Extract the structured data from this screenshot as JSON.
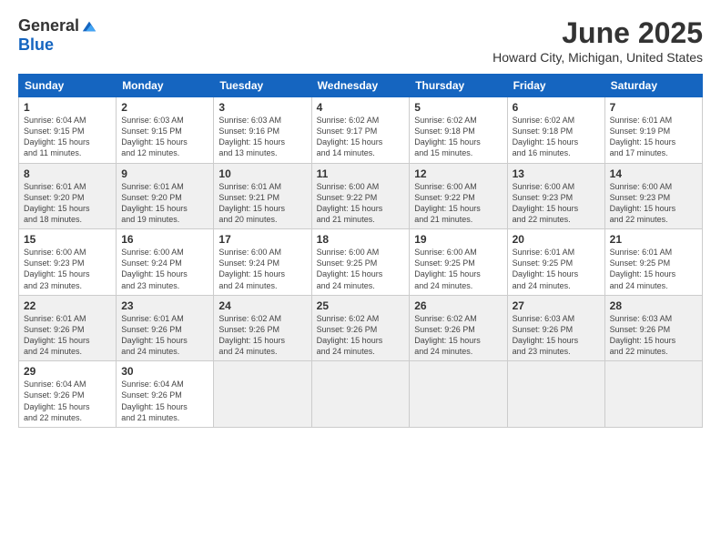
{
  "logo": {
    "general": "General",
    "blue": "Blue"
  },
  "title": "June 2025",
  "subtitle": "Howard City, Michigan, United States",
  "headers": [
    "Sunday",
    "Monday",
    "Tuesday",
    "Wednesday",
    "Thursday",
    "Friday",
    "Saturday"
  ],
  "weeks": [
    [
      {
        "num": "1",
        "info": "Sunrise: 6:04 AM\nSunset: 9:15 PM\nDaylight: 15 hours\nand 11 minutes.",
        "shaded": false
      },
      {
        "num": "2",
        "info": "Sunrise: 6:03 AM\nSunset: 9:15 PM\nDaylight: 15 hours\nand 12 minutes.",
        "shaded": false
      },
      {
        "num": "3",
        "info": "Sunrise: 6:03 AM\nSunset: 9:16 PM\nDaylight: 15 hours\nand 13 minutes.",
        "shaded": false
      },
      {
        "num": "4",
        "info": "Sunrise: 6:02 AM\nSunset: 9:17 PM\nDaylight: 15 hours\nand 14 minutes.",
        "shaded": false
      },
      {
        "num": "5",
        "info": "Sunrise: 6:02 AM\nSunset: 9:18 PM\nDaylight: 15 hours\nand 15 minutes.",
        "shaded": false
      },
      {
        "num": "6",
        "info": "Sunrise: 6:02 AM\nSunset: 9:18 PM\nDaylight: 15 hours\nand 16 minutes.",
        "shaded": false
      },
      {
        "num": "7",
        "info": "Sunrise: 6:01 AM\nSunset: 9:19 PM\nDaylight: 15 hours\nand 17 minutes.",
        "shaded": false
      }
    ],
    [
      {
        "num": "8",
        "info": "Sunrise: 6:01 AM\nSunset: 9:20 PM\nDaylight: 15 hours\nand 18 minutes.",
        "shaded": true
      },
      {
        "num": "9",
        "info": "Sunrise: 6:01 AM\nSunset: 9:20 PM\nDaylight: 15 hours\nand 19 minutes.",
        "shaded": true
      },
      {
        "num": "10",
        "info": "Sunrise: 6:01 AM\nSunset: 9:21 PM\nDaylight: 15 hours\nand 20 minutes.",
        "shaded": true
      },
      {
        "num": "11",
        "info": "Sunrise: 6:00 AM\nSunset: 9:22 PM\nDaylight: 15 hours\nand 21 minutes.",
        "shaded": true
      },
      {
        "num": "12",
        "info": "Sunrise: 6:00 AM\nSunset: 9:22 PM\nDaylight: 15 hours\nand 21 minutes.",
        "shaded": true
      },
      {
        "num": "13",
        "info": "Sunrise: 6:00 AM\nSunset: 9:23 PM\nDaylight: 15 hours\nand 22 minutes.",
        "shaded": true
      },
      {
        "num": "14",
        "info": "Sunrise: 6:00 AM\nSunset: 9:23 PM\nDaylight: 15 hours\nand 22 minutes.",
        "shaded": true
      }
    ],
    [
      {
        "num": "15",
        "info": "Sunrise: 6:00 AM\nSunset: 9:23 PM\nDaylight: 15 hours\nand 23 minutes.",
        "shaded": false
      },
      {
        "num": "16",
        "info": "Sunrise: 6:00 AM\nSunset: 9:24 PM\nDaylight: 15 hours\nand 23 minutes.",
        "shaded": false
      },
      {
        "num": "17",
        "info": "Sunrise: 6:00 AM\nSunset: 9:24 PM\nDaylight: 15 hours\nand 24 minutes.",
        "shaded": false
      },
      {
        "num": "18",
        "info": "Sunrise: 6:00 AM\nSunset: 9:25 PM\nDaylight: 15 hours\nand 24 minutes.",
        "shaded": false
      },
      {
        "num": "19",
        "info": "Sunrise: 6:00 AM\nSunset: 9:25 PM\nDaylight: 15 hours\nand 24 minutes.",
        "shaded": false
      },
      {
        "num": "20",
        "info": "Sunrise: 6:01 AM\nSunset: 9:25 PM\nDaylight: 15 hours\nand 24 minutes.",
        "shaded": false
      },
      {
        "num": "21",
        "info": "Sunrise: 6:01 AM\nSunset: 9:25 PM\nDaylight: 15 hours\nand 24 minutes.",
        "shaded": false
      }
    ],
    [
      {
        "num": "22",
        "info": "Sunrise: 6:01 AM\nSunset: 9:26 PM\nDaylight: 15 hours\nand 24 minutes.",
        "shaded": true
      },
      {
        "num": "23",
        "info": "Sunrise: 6:01 AM\nSunset: 9:26 PM\nDaylight: 15 hours\nand 24 minutes.",
        "shaded": true
      },
      {
        "num": "24",
        "info": "Sunrise: 6:02 AM\nSunset: 9:26 PM\nDaylight: 15 hours\nand 24 minutes.",
        "shaded": true
      },
      {
        "num": "25",
        "info": "Sunrise: 6:02 AM\nSunset: 9:26 PM\nDaylight: 15 hours\nand 24 minutes.",
        "shaded": true
      },
      {
        "num": "26",
        "info": "Sunrise: 6:02 AM\nSunset: 9:26 PM\nDaylight: 15 hours\nand 24 minutes.",
        "shaded": true
      },
      {
        "num": "27",
        "info": "Sunrise: 6:03 AM\nSunset: 9:26 PM\nDaylight: 15 hours\nand 23 minutes.",
        "shaded": true
      },
      {
        "num": "28",
        "info": "Sunrise: 6:03 AM\nSunset: 9:26 PM\nDaylight: 15 hours\nand 22 minutes.",
        "shaded": true
      }
    ],
    [
      {
        "num": "29",
        "info": "Sunrise: 6:04 AM\nSunset: 9:26 PM\nDaylight: 15 hours\nand 22 minutes.",
        "shaded": false
      },
      {
        "num": "30",
        "info": "Sunrise: 6:04 AM\nSunset: 9:26 PM\nDaylight: 15 hours\nand 21 minutes.",
        "shaded": false
      },
      {
        "num": "",
        "info": "",
        "shaded": false,
        "empty": true
      },
      {
        "num": "",
        "info": "",
        "shaded": false,
        "empty": true
      },
      {
        "num": "",
        "info": "",
        "shaded": false,
        "empty": true
      },
      {
        "num": "",
        "info": "",
        "shaded": false,
        "empty": true
      },
      {
        "num": "",
        "info": "",
        "shaded": false,
        "empty": true
      }
    ]
  ]
}
